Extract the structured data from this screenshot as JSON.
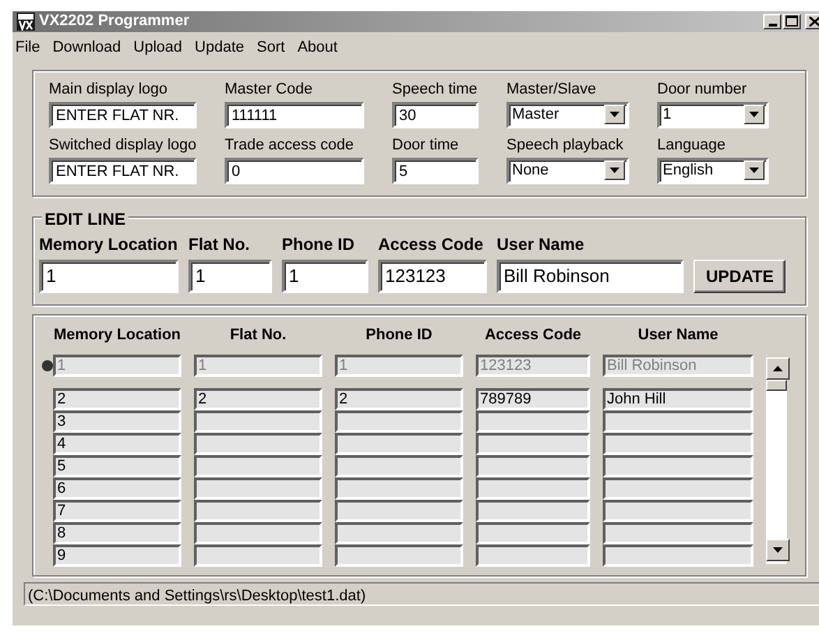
{
  "window": {
    "title": "VX2202 Programmer"
  },
  "menu": [
    "File",
    "Download",
    "Upload",
    "Update",
    "Sort",
    "About"
  ],
  "settings": [
    {
      "label": "Main display logo",
      "value": "ENTER FLAT NR.",
      "kind": "text"
    },
    {
      "label": "Master Code",
      "value": "111111",
      "kind": "text"
    },
    {
      "label": "Speech time",
      "value": "30",
      "kind": "text"
    },
    {
      "label": "Master/Slave",
      "value": "Master",
      "kind": "dropdown"
    },
    {
      "label": "Door number",
      "value": "1",
      "kind": "dropdown"
    },
    {
      "label": "Switched display logo",
      "value": "ENTER FLAT NR.",
      "kind": "text"
    },
    {
      "label": "Trade access code",
      "value": "0",
      "kind": "text"
    },
    {
      "label": "Door time",
      "value": "5",
      "kind": "text"
    },
    {
      "label": "Speech playback",
      "value": "None",
      "kind": "dropdown"
    },
    {
      "label": "Language",
      "value": "English",
      "kind": "dropdown"
    }
  ],
  "edit_line": {
    "title": "EDIT LINE",
    "fields": [
      {
        "label": "Memory Location",
        "value": "1"
      },
      {
        "label": "Flat No.",
        "value": "1"
      },
      {
        "label": "Phone ID",
        "value": "1"
      },
      {
        "label": "Access Code",
        "value": "123123"
      },
      {
        "label": "User Name",
        "value": "Bill Robinson"
      }
    ],
    "button": "UPDATE"
  },
  "table": {
    "columns": [
      "Memory Location",
      "Flat No.",
      "Phone ID",
      "Access Code",
      "User Name"
    ],
    "rows": [
      {
        "selected": true,
        "cells": [
          "1",
          "1",
          "1",
          "123123",
          "Bill Robinson"
        ]
      },
      {
        "selected": false,
        "cells": [
          "2",
          "2",
          "2",
          "789789",
          "John Hill"
        ]
      },
      {
        "selected": false,
        "cells": [
          "3"
        ]
      },
      {
        "selected": false,
        "cells": [
          "4"
        ]
      },
      {
        "selected": false,
        "cells": [
          "5"
        ]
      },
      {
        "selected": false,
        "cells": [
          "6"
        ]
      },
      {
        "selected": false,
        "cells": [
          "7"
        ]
      },
      {
        "selected": false,
        "cells": [
          "8"
        ]
      },
      {
        "selected": false,
        "cells": [
          "9"
        ]
      }
    ]
  },
  "status_bar": "(C:\\Documents and Settings\\rs\\Desktop\\test1.dat)"
}
